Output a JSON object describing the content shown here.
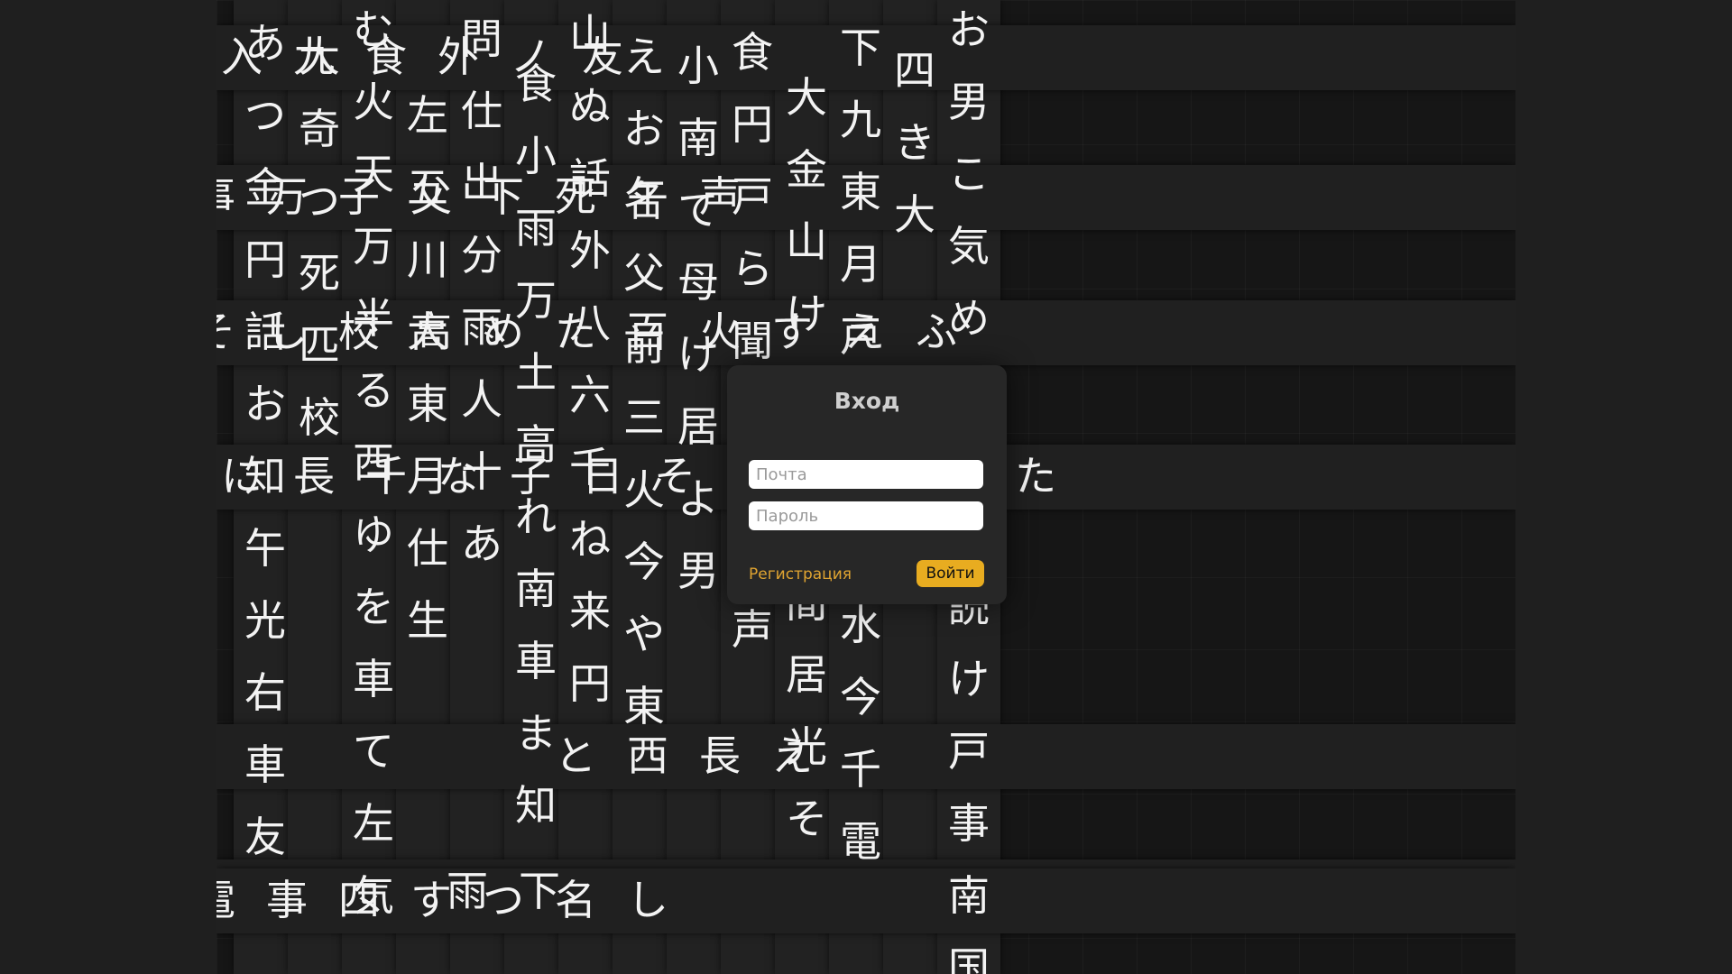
{
  "colors": {
    "page_background": "#1f1f1f",
    "wall_background": "#161616",
    "glyph": "#f3f3f3",
    "card_background": "#272727",
    "accent": "#e8ac20",
    "link": "#e0a431"
  },
  "background_columns": [
    "あつ金円話お知午光右車友",
    "大奇つ死匹校",
    "む火天万半る西ゆを車て左気",
    "左五川大東月仕生",
    "問仕出分雨人十あ",
    "食小雨万土高れ南車ま知",
    "山ぬ話外八六千ね来円",
    "えお名父前三火今や東",
    "小南て母け居よ男",
    "食円戸ら聞ふ北長声",
    "大金山け問う南間居光そ",
    "下九東月戸事見中水今千電",
    "四き大",
    "お男こ気め中そ土読け戸事南国"
  ],
  "background_rows": [
    "入九食外ノ友",
    "事万子父下死午声",
    "そし校高めた百火すえふ",
    "に長千な子日そふほやてた",
    "雨下",
    "電事四すつ名し",
    "と西長え"
  ],
  "login": {
    "title": "Вход",
    "email_placeholder": "Почта",
    "password_placeholder": "Пароль",
    "register_label": "Регистрация",
    "submit_label": "Войти"
  }
}
